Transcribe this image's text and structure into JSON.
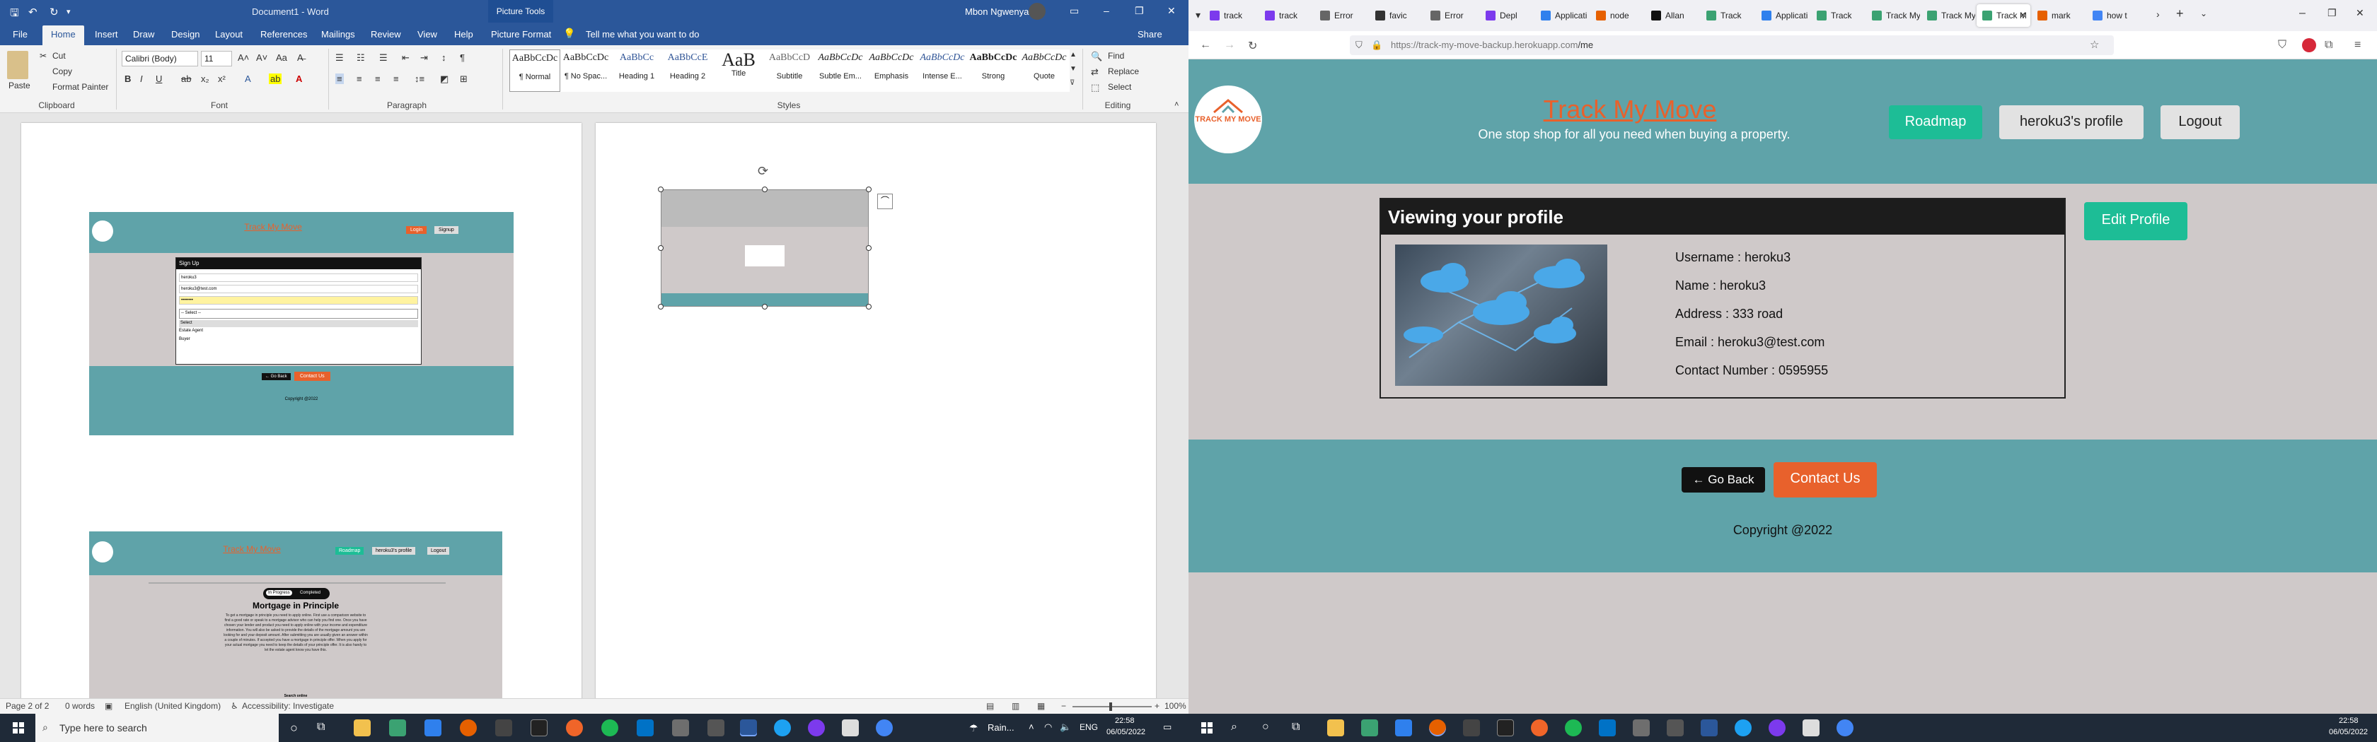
{
  "word": {
    "doc_title": "Document1 - Word",
    "picture_tools": "Picture Tools",
    "user_name": "Mbon Ngwenya",
    "tabs": [
      "File",
      "Home",
      "Insert",
      "Draw",
      "Design",
      "Layout",
      "References",
      "Mailings",
      "Review",
      "View",
      "Help",
      "Picture Format"
    ],
    "tell_me": "Tell me what you want to do",
    "share": "Share",
    "clipboard": {
      "paste": "Paste",
      "cut": "Cut",
      "copy": "Copy",
      "format_painter": "Format Painter",
      "label": "Clipboard"
    },
    "font": {
      "name": "Calibri (Body)",
      "size": "11",
      "label": "Font"
    },
    "paragraph_label": "Paragraph",
    "styles": [
      {
        "sample": "AaBbCcDc",
        "name": "¶ Normal"
      },
      {
        "sample": "AaBbCcDc",
        "name": "¶ No Spac..."
      },
      {
        "sample": "AaBbCc",
        "name": "Heading 1"
      },
      {
        "sample": "AaBbCcE",
        "name": "Heading 2"
      },
      {
        "sample": "AaB",
        "name": "Title"
      },
      {
        "sample": "AaBbCcD",
        "name": "Subtitle"
      },
      {
        "sample": "AaBbCcDc",
        "name": "Subtle Em..."
      },
      {
        "sample": "AaBbCcDc",
        "name": "Emphasis"
      },
      {
        "sample": "AaBbCcDc",
        "name": "Intense E..."
      },
      {
        "sample": "AaBbCcDc",
        "name": "Strong"
      },
      {
        "sample": "AaBbCcDc",
        "name": "Quote"
      }
    ],
    "styles_label": "Styles",
    "editing": {
      "find": "Find",
      "replace": "Replace",
      "select": "Select",
      "label": "Editing"
    },
    "status": {
      "page": "Page 2 of 2",
      "words": "0 words",
      "language": "English (United Kingdom)",
      "accessibility": "Accessibility: Investigate",
      "zoom": "100%"
    },
    "mini1": {
      "title": "Track My Move",
      "login": "Login",
      "signup": "Signup",
      "form_title": "Sign Up",
      "username": "heroku3",
      "email": "heroku3@test.com",
      "password": "••••••••",
      "select": "-- Select --",
      "opt1": "Select",
      "opt2": "Estate Agent",
      "opt3": "Buyer",
      "back": "← Go Back",
      "contact": "Contact Us",
      "copyright": "Copyright @2022"
    },
    "mini2": {
      "title": "Track My Move",
      "roadmap": "Roadmap",
      "profile": "heroku3's profile",
      "logout": "Logout",
      "heading": "Mortgage in Principle",
      "in_progress": "In Progress",
      "completed": "Completed",
      "body": "To get a mortgage in principle you need to apply online. First use a comparison website to find a good rate or speak to a mortgage advisor who can help you find one. Once you have chosen your lender and product you need to apply online with your income and expenditure information. You will also be asked to provide the details of the mortgage amount you are looking for and your deposit amount. After submitting you are usually given an answer within a couple of minutes. If accepted you have a mortgage in principle offer. When you apply for your actual mortgage you need to keep the details of your principle offer. It is also handy to let the estate agent know you have this.",
      "next": "Search online"
    }
  },
  "firefox": {
    "tabs": [
      "track",
      "track",
      "Error",
      "favic",
      "Error",
      "Depl",
      "Applicati",
      "node",
      "Allan",
      "Track",
      "Applicati",
      "Track",
      "Track My",
      "Track My",
      "Track M",
      "mark",
      "how t"
    ],
    "active_tab_index": 14,
    "url": "https://track-my-move-backup.herokuapp.com/me",
    "url_host": "https://track-my-move-backup.herokuapp.com",
    "url_path": "/me"
  },
  "site": {
    "logo_text": "TRACK MY MOVE",
    "title": "Track My Move",
    "tagline": "One stop shop for all you need when buying a property.",
    "nav": {
      "roadmap": "Roadmap",
      "profile": "heroku3's profile",
      "logout": "Logout"
    },
    "card_title": "Viewing your profile",
    "profile_lines": [
      "Username : heroku3",
      "Name : heroku3",
      "Address : 333 road",
      "Email : heroku3@test.com",
      "Contact Number : 0595955"
    ],
    "edit_profile": "Edit Profile",
    "back": "← Go Back",
    "contact": "Contact Us",
    "copyright": "Copyright @2022",
    "colors": {
      "teal": "#5fa3a9",
      "orange": "#e8612c",
      "green": "#1dbd96",
      "body": "#cfc9c9"
    }
  },
  "taskbar": {
    "search": "Type here to search",
    "weather": "Rain...",
    "lang": "ENG",
    "time": "22:58",
    "date": "06/05/2022"
  }
}
